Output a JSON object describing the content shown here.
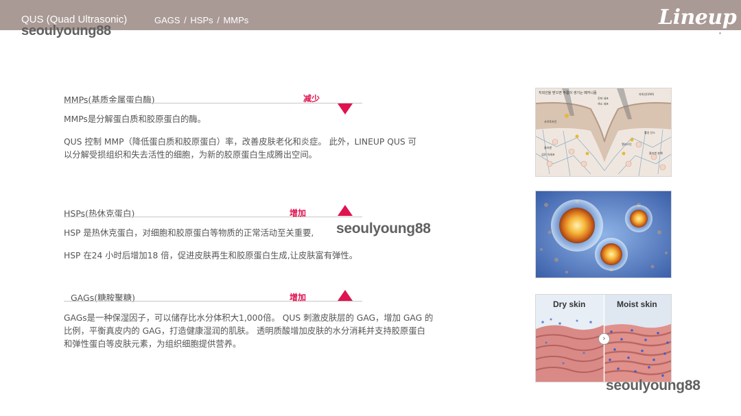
{
  "header": {
    "product": "QUS (Quad Ultrasonic)",
    "breadcrumb": "GAGS  /  HSPs  /  MMPs",
    "brand": "Lineup"
  },
  "watermarks": {
    "top": "seoulyoung88",
    "middle": "seoulyoung88",
    "bottom": "seoulyoung88"
  },
  "sections": {
    "mmps": {
      "title": "MMPs(基质金属蛋白酶)",
      "tag": "减少",
      "trend": "down",
      "desc1": "MMPs是分解蛋白质和胶原蛋白的酶。",
      "desc2_line1": "QUS 控制 MMP（降低蛋白质和胶原蛋白）率，改善皮肤老化和炎症。 此外，LINEUP QUS 可",
      "desc2_line2": "以分解受损组织和失去活性的细胞，为新的胶原蛋白生成腾出空间。"
    },
    "hsps": {
      "title": "HSPs(热休克蛋白)",
      "tag": "增加",
      "trend": "up",
      "desc1": "HSP 是热休克蛋白，对细胞和胶原蛋白等物质的正常活动至关重要,",
      "desc2": "HSP 在24 小时后增加18 倍，促进皮肤再生和胶原蛋白生成,让皮肤富有弹性。"
    },
    "gags": {
      "title": "GAGs(糖胺聚糖)",
      "tag": "增加",
      "trend": "up",
      "desc_line1": "GAGs是一种保湿因子，可以储存比水分体积大1,000倍。 QUS 刺激皮肤层的 GAG，增加 GAG 的",
      "desc_line2": "比例，平衡真皮内的 GAG，打造健康湿润的肌肤。 透明质酸增加皮肤的水分消耗并支持胶原蛋白",
      "desc_line3": "和弹性蛋白等皮肤元素，为组织细胞提供营养。"
    }
  },
  "images": {
    "mmp_diagram": {
      "heading": "지외선을 받으면 주름이 생기는 메커니즘",
      "labels": [
        "자외선(UVA)",
        "진피 세포",
        "색소 세포",
        "사이토카인",
        "콜라겐",
        "활성 산소",
        "엘라스틴",
        "콜라겐 분해",
        "섬유 아세포"
      ]
    },
    "skin_compare": {
      "left_label": "Dry skin",
      "right_label": "Moist skin"
    }
  },
  "colors": {
    "header_bg": "#a99a95",
    "accent": "#e0124f",
    "text": "#555555"
  }
}
